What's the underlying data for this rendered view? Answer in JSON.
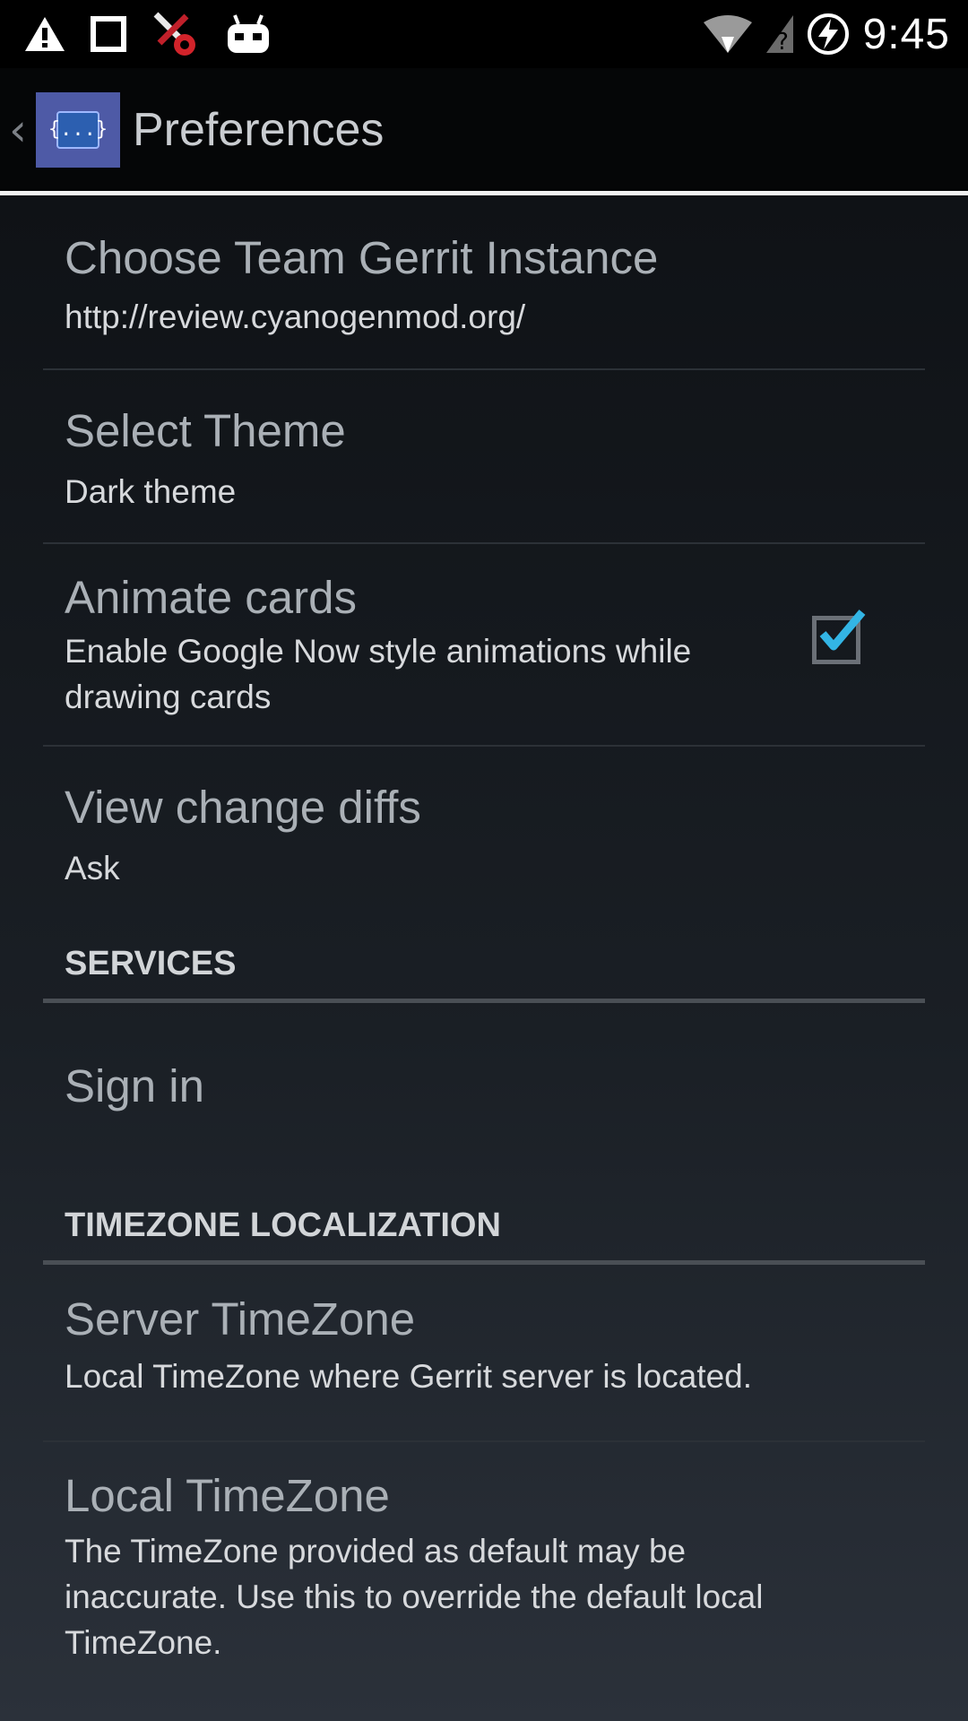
{
  "status_bar": {
    "time": "9:45",
    "icons_left": [
      "warning-icon",
      "square-icon",
      "tools-icon",
      "android-icon"
    ],
    "icons_right": [
      "wifi-icon",
      "signal-unknown-icon",
      "battery-charging-icon"
    ]
  },
  "action_bar": {
    "title": "Preferences",
    "app_icon_text": "{...}"
  },
  "preferences": [
    {
      "title": "Choose Team Gerrit Instance",
      "summary": "http://review.cyanogenmod.org/"
    },
    {
      "title": "Select Theme",
      "summary": "Dark theme"
    },
    {
      "title": "Animate cards",
      "summary": "Enable Google Now style animations while drawing cards",
      "checked": true
    },
    {
      "title": "View change diffs",
      "summary": "Ask"
    }
  ],
  "categories": {
    "services": "SERVICES",
    "timezone": "TIMEZONE LOCALIZATION"
  },
  "services": [
    {
      "title": "Sign in"
    }
  ],
  "timezone_prefs": [
    {
      "title": "Server TimeZone",
      "summary": "Local TimeZone where Gerrit server is located."
    },
    {
      "title": "Local TimeZone",
      "summary": "The TimeZone provided as default may be inaccurate. Use this to override the default local TimeZone."
    }
  ],
  "colors": {
    "checkmark": "#33b5e5",
    "accent_line": "#f2f2f2"
  }
}
